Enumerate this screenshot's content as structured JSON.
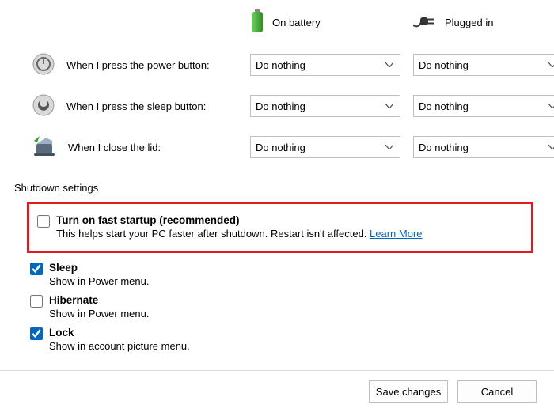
{
  "headers": {
    "battery": "On battery",
    "plugged": "Plugged in"
  },
  "rows": {
    "power": {
      "label": "When I press the power button:",
      "battery": "Do nothing",
      "plugged": "Do nothing"
    },
    "sleep": {
      "label": "When I press the sleep button:",
      "battery": "Do nothing",
      "plugged": "Do nothing"
    },
    "lid": {
      "label": "When I close the lid:",
      "battery": "Do nothing",
      "plugged": "Do nothing"
    }
  },
  "section": "Shutdown settings",
  "options": {
    "fast": {
      "title": "Turn on fast startup (recommended)",
      "descA": "This helps start your PC faster after shutdown. Restart isn't affected. ",
      "learn": "Learn More"
    },
    "sleepOpt": {
      "title": "Sleep",
      "desc": "Show in Power menu."
    },
    "hibernate": {
      "title": "Hibernate",
      "desc": "Show in Power menu."
    },
    "lock": {
      "title": "Lock",
      "desc": "Show in account picture menu."
    }
  },
  "buttons": {
    "save": "Save changes",
    "cancel": "Cancel"
  }
}
